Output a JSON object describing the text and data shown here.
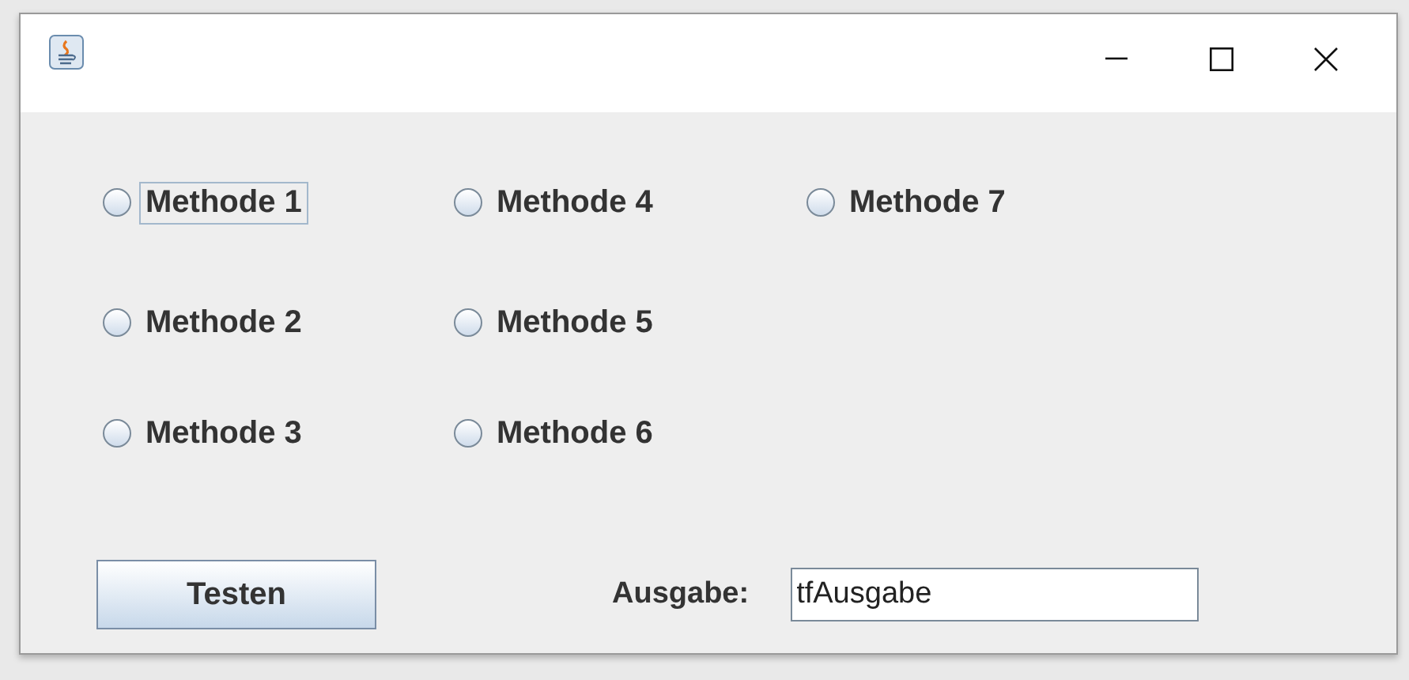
{
  "radios": [
    {
      "label": "Methode 1",
      "selected": false,
      "focused": true
    },
    {
      "label": "Methode 2",
      "selected": false,
      "focused": false
    },
    {
      "label": "Methode 3",
      "selected": false,
      "focused": false
    },
    {
      "label": "Methode 4",
      "selected": false,
      "focused": false
    },
    {
      "label": "Methode 5",
      "selected": false,
      "focused": false
    },
    {
      "label": "Methode 6",
      "selected": false,
      "focused": false
    },
    {
      "label": "Methode 7",
      "selected": false,
      "focused": false
    }
  ],
  "button": {
    "label": "Testen"
  },
  "output": {
    "label": "Ausgabe:",
    "value": "tfAusgabe"
  }
}
